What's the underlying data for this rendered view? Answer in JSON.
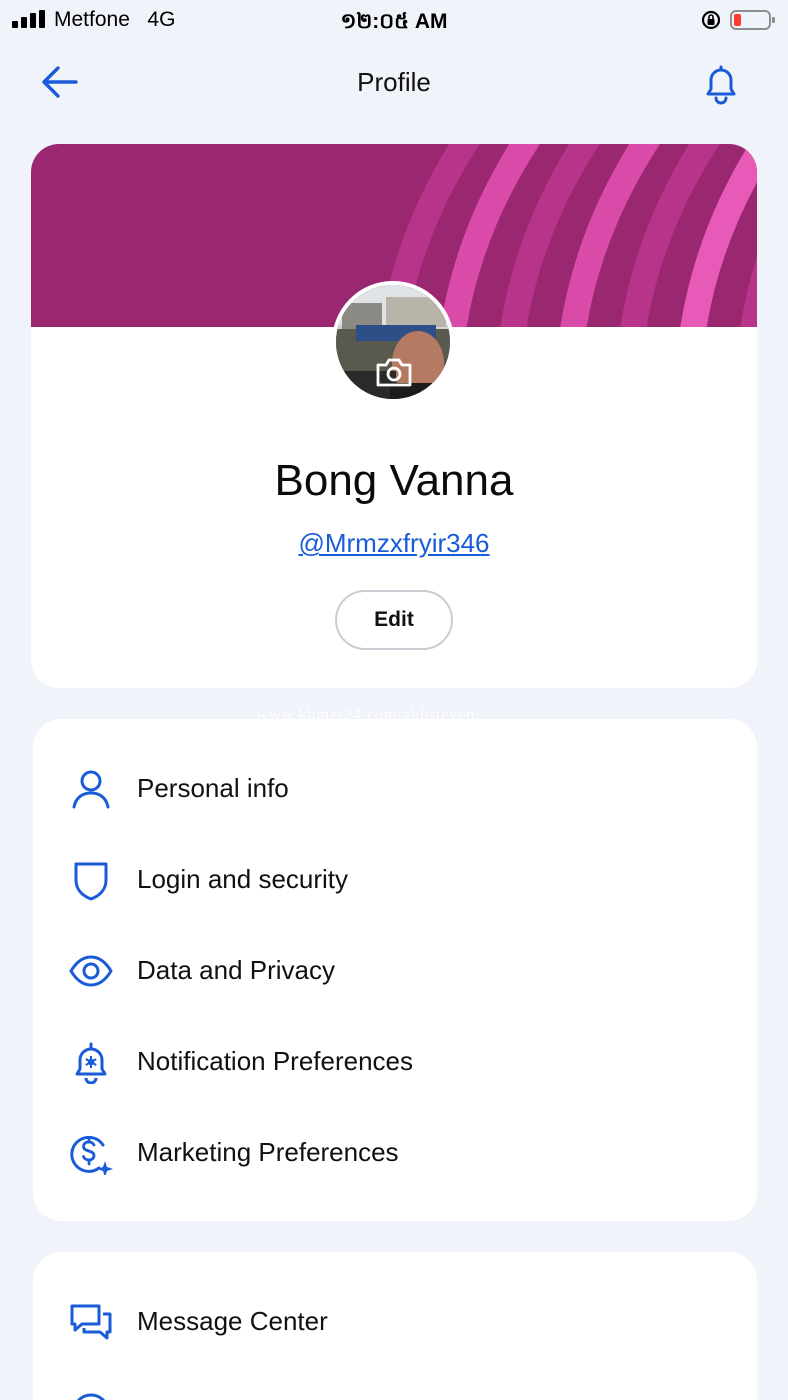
{
  "status_bar": {
    "carrier": "Metfone",
    "network": "4G",
    "time": "១២:០៥ AM"
  },
  "header": {
    "title": "Profile",
    "back_icon": "arrow-left-icon",
    "notification_icon": "bell-icon"
  },
  "profile": {
    "name": "Bong Vanna",
    "username": "@Mrmzxfryir346",
    "edit_label": "Edit",
    "avatar_icon": "camera-icon"
  },
  "watermark": "www.khmer24.com/ahbsteven",
  "account_menu": [
    {
      "label": "Personal info",
      "icon": "person-icon"
    },
    {
      "label": "Login and security",
      "icon": "shield-icon"
    },
    {
      "label": "Data and Privacy",
      "icon": "eye-icon"
    },
    {
      "label": "Notification Preferences",
      "icon": "bell-gear-icon"
    },
    {
      "label": "Marketing Preferences",
      "icon": "dollar-sparkle-icon"
    }
  ],
  "support_menu": [
    {
      "label": "Message Center",
      "icon": "chat-bubbles-icon"
    }
  ],
  "colors": {
    "accent": "#1a5bd8",
    "banner": "#9a2870",
    "background": "#f1f3fa"
  }
}
